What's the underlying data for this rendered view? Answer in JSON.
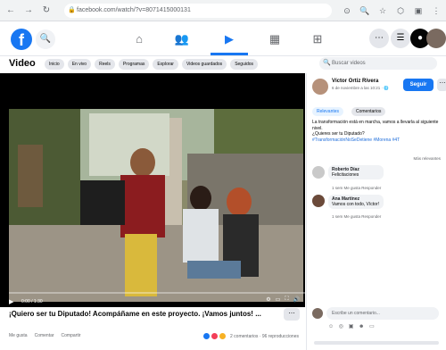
{
  "browser": {
    "back": "←",
    "forward": "→",
    "reload": "↻",
    "url": "facebook.com/watch/?v=8071415000131",
    "icons": [
      "⊙",
      "🔍",
      "☆",
      "⬡",
      "▣",
      "⋮"
    ]
  },
  "fbbar": {
    "logo": "f",
    "search": "🔍",
    "nav": [
      "⌂",
      "👥",
      "▶",
      "▦",
      "⊞"
    ],
    "right": [
      "⋯",
      "☰",
      "●",
      "●"
    ]
  },
  "video_header": {
    "title": "Video",
    "chips": [
      "Inicio",
      "En vivo",
      "Reels",
      "Programas",
      "Explorar",
      "Videos guardados",
      "Seguidos"
    ],
    "search_placeholder": "Buscar videos"
  },
  "player": {
    "play": "▶",
    "time": "0:00 / 1:30",
    "progress_fraction": 0.0,
    "controls": [
      "⚙",
      "▭",
      "⛶",
      "🔊"
    ]
  },
  "post": {
    "caption": "¡Quiero ser tu Diputado! Acompáñame en este proyecto. ¡Vamos juntos! ...",
    "more": "⋯",
    "actions": [
      "Me gusta",
      "Comentar",
      "Compartir"
    ],
    "reactions_text": "2 comentarios · 96 reproducciones"
  },
  "panel": {
    "author": "Víctor Ortiz Rivera",
    "author_sub": "6 de noviembre a las 10:21 · 🌐",
    "follow": "Seguir",
    "more": "⋯",
    "tabs": [
      "Relevantes",
      "Comentarios"
    ],
    "desc_1": "La transformación está en marcha, vamos a llevarla al siguiente nivel.",
    "desc_2": "¿Quieres ser tu Diputado?",
    "desc_link": "#TransformaciónNoSeDetiene #Morena #4T",
    "more_link": "Más relevantes",
    "comments": [
      {
        "name": "Roberto Díaz",
        "text": "Felicitaciones",
        "actions": "1 sem   Me gusta   Responder"
      },
      {
        "name": "Ana Martínez",
        "text": "Vamos con todo, Víctor!",
        "actions": "1 sem   Me gusta   Responder"
      }
    ],
    "comment_placeholder": "Escribe un comentario...",
    "comment_icons": "☺ ◎ ▣ ☻ ▭"
  },
  "colors": {
    "brand": "#1877f2",
    "like": "#1877f2",
    "love": "#f33e58",
    "haha": "#f7b125"
  }
}
